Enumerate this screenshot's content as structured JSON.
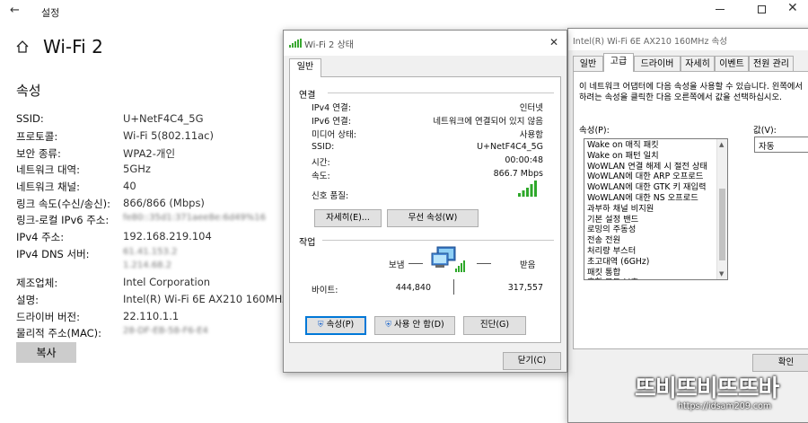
{
  "settings": {
    "window_title": "설정",
    "page_title": "Wi-Fi 2",
    "section_title": "속성",
    "properties": [
      {
        "label": "SSID:",
        "value": "U+NetF4C4_5G"
      },
      {
        "label": "프로토콜:",
        "value": "Wi-Fi 5(802.11ac)"
      },
      {
        "label": "보안 종류:",
        "value": "WPA2-개인"
      },
      {
        "label": "네트워크 대역:",
        "value": "5GHz"
      },
      {
        "label": "네트워크 채널:",
        "value": "40"
      },
      {
        "label": "링크 속도(수신/송신):",
        "value": "866/866 (Mbps)"
      },
      {
        "label": "링크-로컬 IPv6 주소:",
        "value": "fe80::35d1:371aee8e:6d49%16"
      },
      {
        "label": "IPv4 주소:",
        "value": "192.168.219.104"
      },
      {
        "label": "IPv4 DNS 서버:",
        "value": "61.41.153.2",
        "value2": "1.214.68.2"
      },
      {
        "label": "제조업체:",
        "value": "Intel Corporation"
      },
      {
        "label": "설명:",
        "value": "Intel(R) Wi-Fi 6E AX210 160MHz"
      },
      {
        "label": "드라이버 버전:",
        "value": "22.110.1.1"
      },
      {
        "label": "물리적 주소(MAC):",
        "value": "28-DF-EB-58-F6-E4"
      }
    ],
    "copy_button": "복사"
  },
  "status_dialog": {
    "title": "Wi-Fi 2 상태",
    "tab": "일반",
    "connection_header": "연결",
    "rows": [
      {
        "label": "IPv4 연결:",
        "value": "인터넷"
      },
      {
        "label": "IPv6 연결:",
        "value": "네트워크에 연결되어 있지 않음"
      },
      {
        "label": "미디어 상태:",
        "value": "사용함"
      },
      {
        "label": "SSID:",
        "value": "U+NetF4C4_5G"
      },
      {
        "label": "시간:",
        "value": "00:00:48"
      },
      {
        "label": "속도:",
        "value": "866.7 Mbps"
      }
    ],
    "signal_label": "신호 품질:",
    "details_button": "자세히(E)...",
    "wireless_props_button": "무선 속성(W)",
    "activity_header": "작업",
    "sent_label": "보냄",
    "received_label": "받음",
    "bytes_label": "바이트:",
    "bytes_sent": "444,840",
    "bytes_received": "317,557",
    "properties_button": "속성(P)",
    "disable_button": "사용 안 함(D)",
    "diagnose_button": "진단(G)",
    "close_button": "닫기(C)"
  },
  "adapter_dialog": {
    "title": "Intel(R) Wi-Fi 6E AX210 160MHz 속성",
    "tabs": [
      "일반",
      "고급",
      "드라이버",
      "자세히",
      "이벤트",
      "전원 관리"
    ],
    "description_line1": "이 네트워크 어댑터에 다음 속성을 사용할 수 있습니다. 왼쪽에서",
    "description_line2": "하려는 속성을 클릭한 다음 오른쪽에서 값을 선택하십시오.",
    "property_label": "속성(P):",
    "value_label": "값(V):",
    "property_items": [
      "Wake on 매직 패킷",
      "Wake on 패턴 일치",
      "WoWLAN 연결 해제 시 절전 상태",
      "WoWLAN에 대한 ARP 오프로드",
      "WoWLAN에 대한 GTK 키 재입력",
      "WoWLAN에 대한 NS 오프로드",
      "과부하 채널 비지원",
      "기본 설정 밴드",
      "로밍의 주동성",
      "전송 전원",
      "처리량 부스터",
      "초고대역 (6GHz)",
      "패킷 통합",
      "혼합 모드 보호"
    ],
    "value_selected": "자동",
    "ok_button": "확인"
  },
  "watermark": {
    "logo_text": "뜨비뜨비뜨뜨바",
    "url": "https://idsam209.com"
  }
}
